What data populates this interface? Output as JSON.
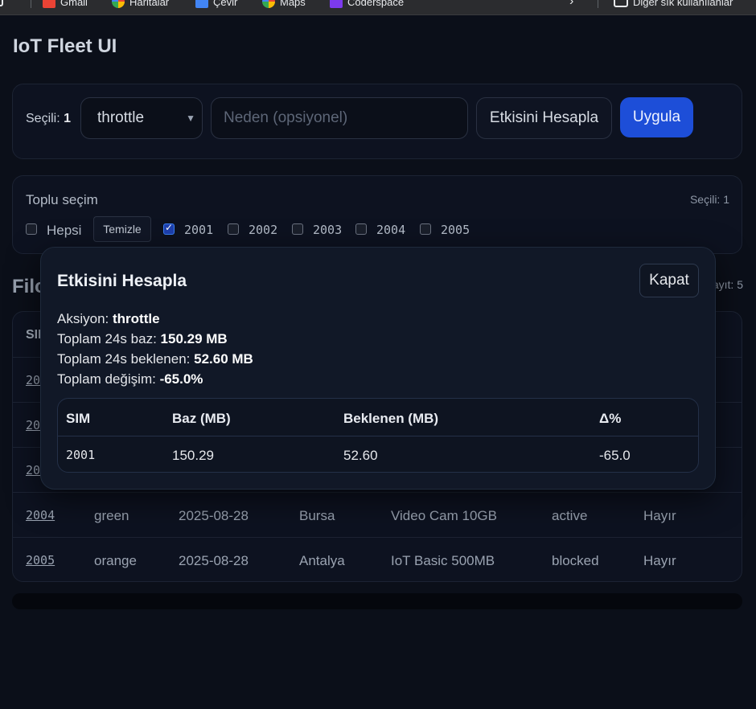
{
  "bookmarks": [
    {
      "label": "Gmail",
      "icon": "gmail-icon",
      "color": "#ea4335"
    },
    {
      "label": "Haritalar",
      "icon": "maps-icon",
      "color": "#34a853"
    },
    {
      "label": "Çevir",
      "icon": "translate-icon",
      "color": "#4285f4"
    },
    {
      "label": "Maps",
      "icon": "maps-icon",
      "color": "#34a853"
    },
    {
      "label": "Coderspace",
      "icon": "coderspace-icon",
      "color": "#7c3aed"
    }
  ],
  "bookmarks_other": "Diğer sık kullanılanlar",
  "app_title": "IoT Fleet UI",
  "action_bar": {
    "selected_label": "Seçili:",
    "selected_count": "1",
    "action_select_value": "throttle",
    "reason_placeholder": "Neden (opsiyonel)",
    "simulate_label": "Etkisini Hesapla",
    "apply_label": "Uygula"
  },
  "bulk": {
    "title": "Toplu seçim",
    "selected_summary": "Seçili: 1",
    "all_label": "Hepsi",
    "clear_label": "Temizle",
    "sims": [
      {
        "id": "2001",
        "checked": true
      },
      {
        "id": "2002",
        "checked": false
      },
      {
        "id": "2003",
        "checked": false
      },
      {
        "id": "2004",
        "checked": false
      },
      {
        "id": "2005",
        "checked": false
      }
    ]
  },
  "fleet": {
    "title_visible": "Filo",
    "count_visible": "ayıt: 5",
    "header_visible": "SIM",
    "rows": [
      {
        "sim": "2001"
      },
      {
        "sim": "2002"
      },
      {
        "sim": "2003"
      },
      {
        "sim": "2004",
        "status": "green",
        "date": "2025-08-28",
        "city": "Bursa",
        "plan": "Video Cam 10GB",
        "state": "active",
        "flag": "Hayır"
      },
      {
        "sim": "2005",
        "status": "orange",
        "date": "2025-08-28",
        "city": "Antalya",
        "plan": "IoT Basic 500MB",
        "state": "blocked",
        "flag": "Hayır"
      }
    ]
  },
  "modal": {
    "title": "Etkisini Hesapla",
    "close_label": "Kapat",
    "action_label": "Aksiyon:",
    "action_value": "throttle",
    "base_label": "Toplam 24s baz:",
    "base_value": "150.29 MB",
    "expected_label": "Toplam 24s beklenen:",
    "expected_value": "52.60 MB",
    "change_label": "Toplam değişim:",
    "change_value": "-65.0%",
    "table": {
      "headers": [
        "SIM",
        "Baz (MB)",
        "Beklenen (MB)",
        "Δ%"
      ],
      "rows": [
        [
          "2001",
          "150.29",
          "52.60",
          "-65.0"
        ]
      ]
    }
  }
}
